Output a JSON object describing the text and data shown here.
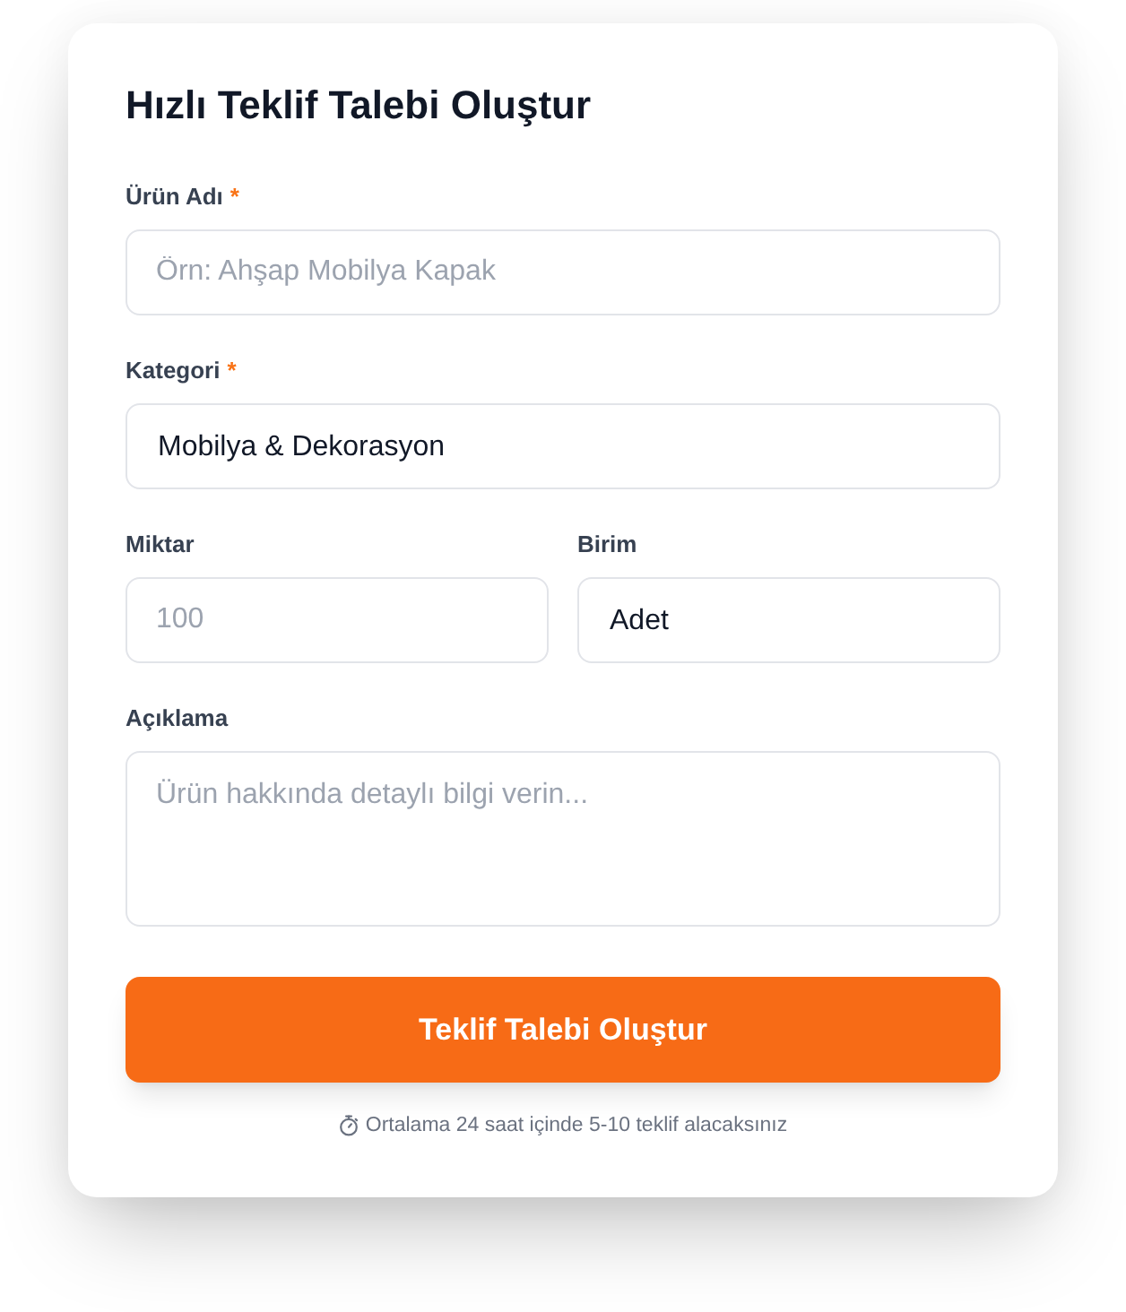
{
  "form": {
    "title": "Hızlı Teklif Talebi Oluştur",
    "rows": [
      {
        "fields": [
          {
            "kind": "text",
            "label": "Ürün Adı",
            "required_mark": "*",
            "placeholder": "Örn: Ahşap Mobilya Kapak"
          }
        ]
      },
      {
        "fields": [
          {
            "kind": "select",
            "label": "Kategori",
            "required_mark": "*",
            "value": "Mobilya & Dekorasyon"
          }
        ]
      },
      {
        "fields": [
          {
            "kind": "number",
            "label": "Miktar",
            "placeholder": "100"
          },
          {
            "kind": "select",
            "label": "Birim",
            "value": "Adet"
          }
        ]
      },
      {
        "fields": [
          {
            "kind": "textarea",
            "label": "Açıklama",
            "placeholder": "Ürün hakkında detaylı bilgi verin..."
          }
        ]
      }
    ],
    "submit_button": {
      "label": "Teklif Talebi Oluştur"
    },
    "note": {
      "text": "Ortalama 24 saat içinde 5-10 teklif alacaksınız"
    }
  }
}
